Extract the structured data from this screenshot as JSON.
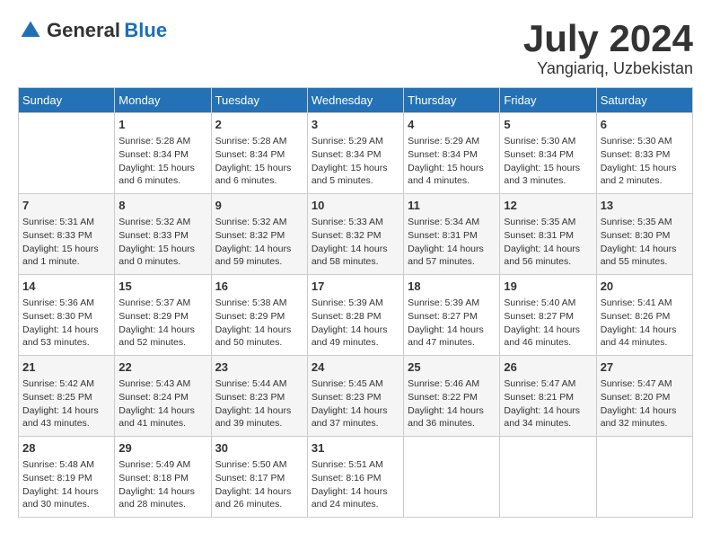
{
  "logo": {
    "general": "General",
    "blue": "Blue"
  },
  "title": {
    "month_year": "July 2024",
    "location": "Yangiariq, Uzbekistan"
  },
  "days_of_week": [
    "Sunday",
    "Monday",
    "Tuesday",
    "Wednesday",
    "Thursday",
    "Friday",
    "Saturday"
  ],
  "weeks": [
    [
      {
        "day": "",
        "sunrise": "",
        "sunset": "",
        "daylight": ""
      },
      {
        "day": "1",
        "sunrise": "Sunrise: 5:28 AM",
        "sunset": "Sunset: 8:34 PM",
        "daylight": "Daylight: 15 hours and 6 minutes."
      },
      {
        "day": "2",
        "sunrise": "Sunrise: 5:28 AM",
        "sunset": "Sunset: 8:34 PM",
        "daylight": "Daylight: 15 hours and 6 minutes."
      },
      {
        "day": "3",
        "sunrise": "Sunrise: 5:29 AM",
        "sunset": "Sunset: 8:34 PM",
        "daylight": "Daylight: 15 hours and 5 minutes."
      },
      {
        "day": "4",
        "sunrise": "Sunrise: 5:29 AM",
        "sunset": "Sunset: 8:34 PM",
        "daylight": "Daylight: 15 hours and 4 minutes."
      },
      {
        "day": "5",
        "sunrise": "Sunrise: 5:30 AM",
        "sunset": "Sunset: 8:34 PM",
        "daylight": "Daylight: 15 hours and 3 minutes."
      },
      {
        "day": "6",
        "sunrise": "Sunrise: 5:30 AM",
        "sunset": "Sunset: 8:33 PM",
        "daylight": "Daylight: 15 hours and 2 minutes."
      }
    ],
    [
      {
        "day": "7",
        "sunrise": "Sunrise: 5:31 AM",
        "sunset": "Sunset: 8:33 PM",
        "daylight": "Daylight: 15 hours and 1 minute."
      },
      {
        "day": "8",
        "sunrise": "Sunrise: 5:32 AM",
        "sunset": "Sunset: 8:33 PM",
        "daylight": "Daylight: 15 hours and 0 minutes."
      },
      {
        "day": "9",
        "sunrise": "Sunrise: 5:32 AM",
        "sunset": "Sunset: 8:32 PM",
        "daylight": "Daylight: 14 hours and 59 minutes."
      },
      {
        "day": "10",
        "sunrise": "Sunrise: 5:33 AM",
        "sunset": "Sunset: 8:32 PM",
        "daylight": "Daylight: 14 hours and 58 minutes."
      },
      {
        "day": "11",
        "sunrise": "Sunrise: 5:34 AM",
        "sunset": "Sunset: 8:31 PM",
        "daylight": "Daylight: 14 hours and 57 minutes."
      },
      {
        "day": "12",
        "sunrise": "Sunrise: 5:35 AM",
        "sunset": "Sunset: 8:31 PM",
        "daylight": "Daylight: 14 hours and 56 minutes."
      },
      {
        "day": "13",
        "sunrise": "Sunrise: 5:35 AM",
        "sunset": "Sunset: 8:30 PM",
        "daylight": "Daylight: 14 hours and 55 minutes."
      }
    ],
    [
      {
        "day": "14",
        "sunrise": "Sunrise: 5:36 AM",
        "sunset": "Sunset: 8:30 PM",
        "daylight": "Daylight: 14 hours and 53 minutes."
      },
      {
        "day": "15",
        "sunrise": "Sunrise: 5:37 AM",
        "sunset": "Sunset: 8:29 PM",
        "daylight": "Daylight: 14 hours and 52 minutes."
      },
      {
        "day": "16",
        "sunrise": "Sunrise: 5:38 AM",
        "sunset": "Sunset: 8:29 PM",
        "daylight": "Daylight: 14 hours and 50 minutes."
      },
      {
        "day": "17",
        "sunrise": "Sunrise: 5:39 AM",
        "sunset": "Sunset: 8:28 PM",
        "daylight": "Daylight: 14 hours and 49 minutes."
      },
      {
        "day": "18",
        "sunrise": "Sunrise: 5:39 AM",
        "sunset": "Sunset: 8:27 PM",
        "daylight": "Daylight: 14 hours and 47 minutes."
      },
      {
        "day": "19",
        "sunrise": "Sunrise: 5:40 AM",
        "sunset": "Sunset: 8:27 PM",
        "daylight": "Daylight: 14 hours and 46 minutes."
      },
      {
        "day": "20",
        "sunrise": "Sunrise: 5:41 AM",
        "sunset": "Sunset: 8:26 PM",
        "daylight": "Daylight: 14 hours and 44 minutes."
      }
    ],
    [
      {
        "day": "21",
        "sunrise": "Sunrise: 5:42 AM",
        "sunset": "Sunset: 8:25 PM",
        "daylight": "Daylight: 14 hours and 43 minutes."
      },
      {
        "day": "22",
        "sunrise": "Sunrise: 5:43 AM",
        "sunset": "Sunset: 8:24 PM",
        "daylight": "Daylight: 14 hours and 41 minutes."
      },
      {
        "day": "23",
        "sunrise": "Sunrise: 5:44 AM",
        "sunset": "Sunset: 8:23 PM",
        "daylight": "Daylight: 14 hours and 39 minutes."
      },
      {
        "day": "24",
        "sunrise": "Sunrise: 5:45 AM",
        "sunset": "Sunset: 8:23 PM",
        "daylight": "Daylight: 14 hours and 37 minutes."
      },
      {
        "day": "25",
        "sunrise": "Sunrise: 5:46 AM",
        "sunset": "Sunset: 8:22 PM",
        "daylight": "Daylight: 14 hours and 36 minutes."
      },
      {
        "day": "26",
        "sunrise": "Sunrise: 5:47 AM",
        "sunset": "Sunset: 8:21 PM",
        "daylight": "Daylight: 14 hours and 34 minutes."
      },
      {
        "day": "27",
        "sunrise": "Sunrise: 5:47 AM",
        "sunset": "Sunset: 8:20 PM",
        "daylight": "Daylight: 14 hours and 32 minutes."
      }
    ],
    [
      {
        "day": "28",
        "sunrise": "Sunrise: 5:48 AM",
        "sunset": "Sunset: 8:19 PM",
        "daylight": "Daylight: 14 hours and 30 minutes."
      },
      {
        "day": "29",
        "sunrise": "Sunrise: 5:49 AM",
        "sunset": "Sunset: 8:18 PM",
        "daylight": "Daylight: 14 hours and 28 minutes."
      },
      {
        "day": "30",
        "sunrise": "Sunrise: 5:50 AM",
        "sunset": "Sunset: 8:17 PM",
        "daylight": "Daylight: 14 hours and 26 minutes."
      },
      {
        "day": "31",
        "sunrise": "Sunrise: 5:51 AM",
        "sunset": "Sunset: 8:16 PM",
        "daylight": "Daylight: 14 hours and 24 minutes."
      },
      {
        "day": "",
        "sunrise": "",
        "sunset": "",
        "daylight": ""
      },
      {
        "day": "",
        "sunrise": "",
        "sunset": "",
        "daylight": ""
      },
      {
        "day": "",
        "sunrise": "",
        "sunset": "",
        "daylight": ""
      }
    ]
  ]
}
